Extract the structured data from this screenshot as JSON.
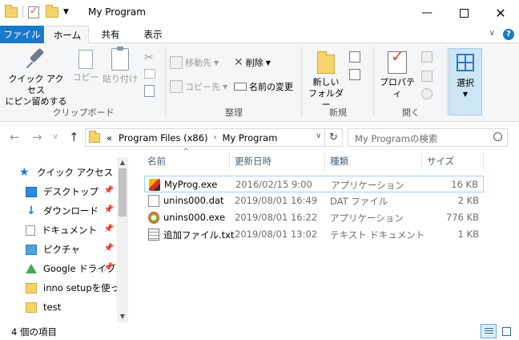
{
  "window": {
    "title": "My Program"
  },
  "ribbon_tabs": {
    "file": "ファイル",
    "home": "ホーム",
    "share": "共有",
    "view": "表示"
  },
  "ribbon": {
    "clipboard": {
      "group_label": "クリップボード",
      "pin_quick_access_line1": "クイック アクセス",
      "pin_quick_access_line2": "にピン留めする",
      "copy": "コピー",
      "paste": "貼り付け"
    },
    "organize": {
      "group_label": "整理",
      "move_to": "移動先",
      "copy_to": "コピー先",
      "delete": "削除",
      "rename": "名前の変更"
    },
    "new": {
      "group_label": "新規",
      "new_folder_line1": "新しい",
      "new_folder_line2": "フォルダー"
    },
    "open": {
      "group_label": "開く",
      "properties": "プロパティ"
    },
    "select": {
      "label": "選択"
    }
  },
  "address": {
    "overflow": "«",
    "crumbs": [
      "Program Files (x86)",
      "My Program"
    ]
  },
  "search": {
    "placeholder": "My Programの検索"
  },
  "nav_pane": {
    "items": [
      {
        "label": "クイック アクセス",
        "icon": "star-icon"
      },
      {
        "label": "デスクトップ",
        "icon": "desktop-icon",
        "pinned": true
      },
      {
        "label": "ダウンロード",
        "icon": "download-icon",
        "pinned": true
      },
      {
        "label": "ドキュメント",
        "icon": "documents-icon",
        "pinned": true
      },
      {
        "label": "ピクチャ",
        "icon": "pictures-icon",
        "pinned": true
      },
      {
        "label": "Google ドライブ",
        "icon": "google-drive-icon",
        "pinned": true
      },
      {
        "label": "inno setupを使って",
        "icon": "folder-icon"
      },
      {
        "label": "test",
        "icon": "folder-icon"
      }
    ]
  },
  "file_list": {
    "columns": {
      "name": "名前",
      "modified": "更新日時",
      "type": "種類",
      "size": "サイズ"
    },
    "rows": [
      {
        "name": "MyProg.exe",
        "modified": "2016/02/15 9:00",
        "type": "アプリケーション",
        "size": "16 KB",
        "icon": "exe-icon",
        "selected": true
      },
      {
        "name": "unins000.dat",
        "modified": "2019/08/01 16:49",
        "type": "DAT ファイル",
        "size": "2 KB",
        "icon": "dat-file-icon"
      },
      {
        "name": "unins000.exe",
        "modified": "2019/08/01 16:22",
        "type": "アプリケーション",
        "size": "776 KB",
        "icon": "uninstaller-icon"
      },
      {
        "name": "追加ファイル.txt",
        "modified": "2019/08/01 13:02",
        "type": "テキスト ドキュメント",
        "size": "1 KB",
        "icon": "text-file-icon"
      }
    ]
  },
  "status": {
    "item_count": "4 個の項目"
  },
  "colors": {
    "file_tab": "#1979ca",
    "selection_border": "#99d1ff",
    "ribbon_bg": "#f5f6f7"
  }
}
